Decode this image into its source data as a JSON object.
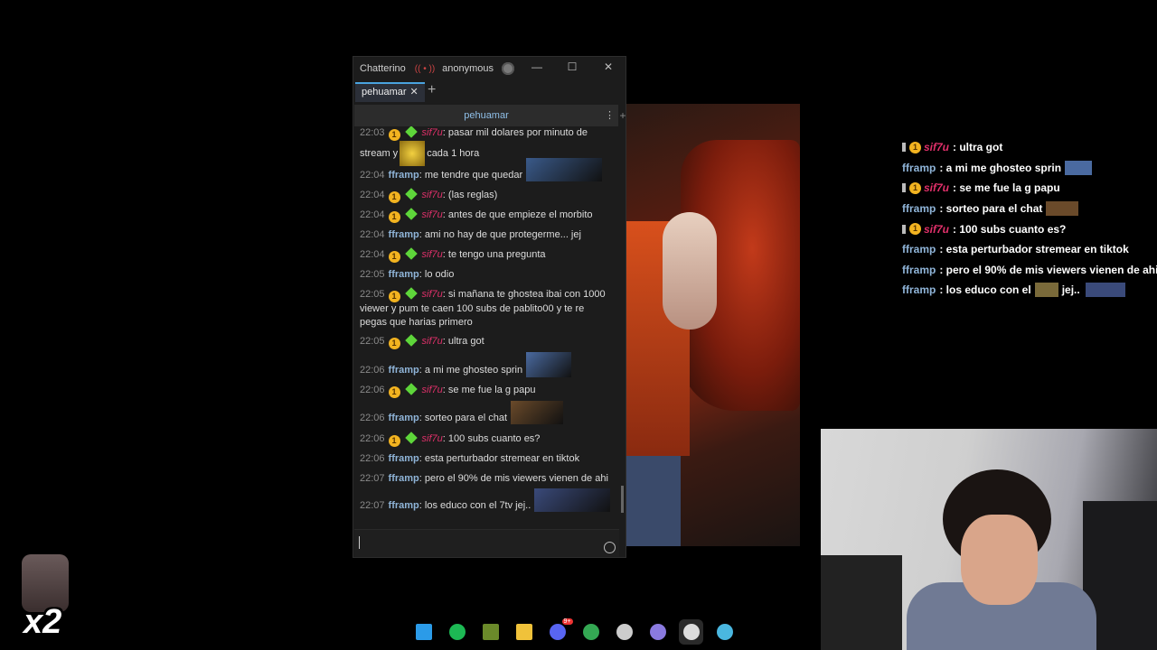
{
  "window": {
    "app_name": "Chatterino",
    "live_icon": "(( • ))",
    "account": "anonymous",
    "minimize": "—",
    "maximize": "☐",
    "close": "✕"
  },
  "tabs": [
    {
      "label": "pehuamar",
      "close": "✕"
    }
  ],
  "add_tab": "+",
  "channel_header": {
    "name": "pehuamar",
    "more": "⋮",
    "add_split": "+"
  },
  "messages": [
    {
      "time": "22:03",
      "user": "sif7u",
      "user_type": "sif",
      "text": "pasar mil dolares por minuto de",
      "text2": "stream y",
      "text3": "cada 1 hora"
    },
    {
      "time": "22:04",
      "user": "fframp",
      "user_type": "ff",
      "text": "me tendre que quedar"
    },
    {
      "time": "22:04",
      "user": "sif7u",
      "user_type": "sif",
      "text": "(las reglas)"
    },
    {
      "time": "22:04",
      "user": "sif7u",
      "user_type": "sif",
      "text": "antes de que empieze el morbito"
    },
    {
      "time": "22:04",
      "user": "fframp",
      "user_type": "ff",
      "text": "ami no hay de que protegerme... jej"
    },
    {
      "time": "22:04",
      "user": "sif7u",
      "user_type": "sif",
      "text": "te tengo una pregunta"
    },
    {
      "time": "22:05",
      "user": "fframp",
      "user_type": "ff",
      "text": "lo odio"
    },
    {
      "time": "22:05",
      "user": "sif7u",
      "user_type": "sif",
      "text": "si mañana te ghostea ibai con 1000",
      "text2": "viewer y pum te caen 100 subs de pablito00 y te re",
      "text3": "pegas que harias primero"
    },
    {
      "time": "22:05",
      "user": "sif7u",
      "user_type": "sif",
      "text": "ultra got"
    },
    {
      "time": "22:06",
      "user": "fframp",
      "user_type": "ff",
      "text": "a mi me ghosteo sprin"
    },
    {
      "time": "22:06",
      "user": "sif7u",
      "user_type": "sif",
      "text": "se me fue la g papu"
    },
    {
      "time": "22:06",
      "user": "fframp",
      "user_type": "ff",
      "text": "sorteo para el chat"
    },
    {
      "time": "22:06",
      "user": "sif7u",
      "user_type": "sif",
      "text": "100 subs cuanto es?"
    },
    {
      "time": "22:06",
      "user": "fframp",
      "user_type": "ff",
      "text": "esta perturbador stremear en tiktok"
    },
    {
      "time": "22:07",
      "user": "fframp",
      "user_type": "ff",
      "text": "pero el 90% de mis viewers vienen de ahi"
    },
    {
      "time": "22:07",
      "user": "fframp",
      "user_type": "ff",
      "text": "los educo con el 7tv jej.."
    }
  ],
  "badge_number": "1",
  "overlay": [
    {
      "user": "sif7u",
      "text": ": ultra got",
      "type": "sif"
    },
    {
      "user": "fframp",
      "text": ": a mi me ghosteo sprin",
      "type": "ff"
    },
    {
      "user": "sif7u",
      "text": ": se me fue la g papu",
      "type": "sif"
    },
    {
      "user": "fframp",
      "text": ": sorteo para el chat",
      "type": "ff"
    },
    {
      "user": "sif7u",
      "text": ": 100 subs cuanto es?",
      "type": "sif"
    },
    {
      "user": "fframp",
      "text": ": esta perturbador stremear en tiktok",
      "type": "ff"
    },
    {
      "user": "fframp",
      "text": ": pero el 90% de mis viewers vienen de ahi",
      "type": "ff"
    },
    {
      "user": "fframp",
      "text": ": los educo con el",
      "text2": "jej..",
      "type": "ff"
    }
  ],
  "multiplier": "x2",
  "taskbar": [
    {
      "name": "windows-start-icon",
      "color": "#2b9be8"
    },
    {
      "name": "spotify-icon",
      "color": "#1db954"
    },
    {
      "name": "minecraft-icon",
      "color": "#6b8a2a"
    },
    {
      "name": "file-explorer-icon",
      "color": "#f0c23a"
    },
    {
      "name": "discord-icon",
      "color": "#5865f2"
    },
    {
      "name": "chrome-icon",
      "color": "#34a853"
    },
    {
      "name": "obs-icon",
      "color": "#cccccc"
    },
    {
      "name": "chat-bubble-icon",
      "color": "#8a7adf"
    },
    {
      "name": "chatterino-icon",
      "color": "#dddddd"
    },
    {
      "name": "streamlabs-icon",
      "color": "#4ab7e0"
    }
  ],
  "discord_badge": "9+"
}
